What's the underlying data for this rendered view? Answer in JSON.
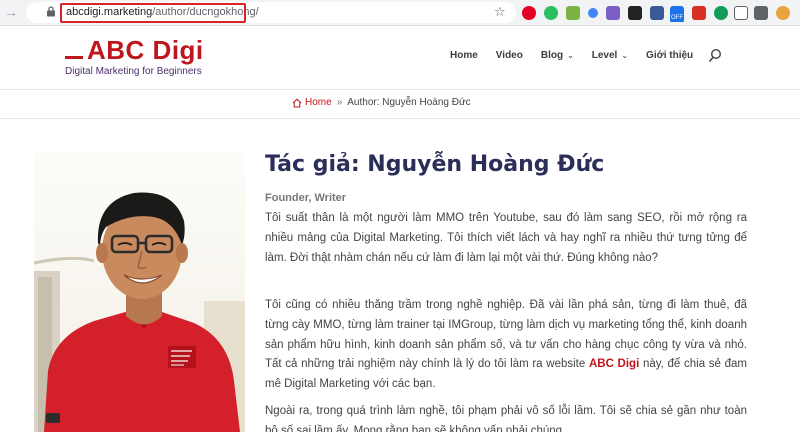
{
  "browser": {
    "url_domain": "abcdigi.marketing",
    "url_path": "/author/ducngokhong/",
    "extension_badge": "OFF"
  },
  "site": {
    "logo_text": "ABC Digi",
    "tagline": "Digital Marketing for Beginners",
    "brand_color": "#c0151c",
    "nav": [
      {
        "label": "Home",
        "dropdown": false
      },
      {
        "label": "Video",
        "dropdown": false
      },
      {
        "label": "Blog",
        "dropdown": true
      },
      {
        "label": "Level",
        "dropdown": true
      },
      {
        "label": "Giới thiệu",
        "dropdown": false
      }
    ]
  },
  "breadcrumb": {
    "home": "Home",
    "separator": "»",
    "current": "Author: Nguyễn Hoàng Đức"
  },
  "author": {
    "title": "Tác giả: Nguyễn Hoàng Đức",
    "roles": "Founder, Writer",
    "paragraphs": [
      {
        "before": "Tôi suất thân là một người làm MMO trên Youtube, sau đó làm sang SEO, rồi mở rộng ra nhiều mảng của Digital Marketing. Tôi thích viết lách và hay nghĩ ra nhiều thứ tưng tửng để làm. Đời thật nhàm chán nếu cứ làm đi làm lại một vài thứ. Đúng không nào?",
        "brand": "",
        "after": ""
      },
      {
        "before": "Tôi cũng có nhiều thăng trầm trong nghề nghiệp. Đã vài lần phá sản, từng đi làm thuê, đã từng cày MMO, từng làm trainer tại IMGroup, từng làm dịch vụ marketing tổng thể, kinh doanh sản phẩm hữu hình, kinh doanh sản phẩm số, và tư vấn cho hàng chục công ty vừa và nhỏ. Tất cả những trải nghiệm này chính là lý do tôi làm ra website ",
        "brand": "ABC Digi",
        "after": " này, để chia sẻ đam mê Digital Marketing với các bạn."
      },
      {
        "before": "Ngoài ra, trong quá trình làm nghề, tôi phạm phải vô số lỗi lầm. Tôi sẽ chia sẻ gần như toàn bộ số sai lầm ấy. Mong rằng bạn sẽ không vấp phải chúng.",
        "brand": "",
        "after": ""
      }
    ],
    "shirt_text": "THE FUTURE STARTS NOW TOMORROW"
  }
}
